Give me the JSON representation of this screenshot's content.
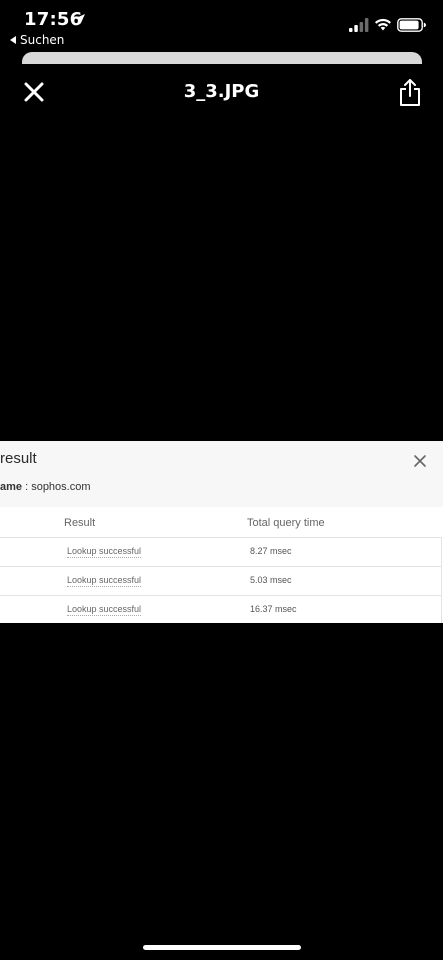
{
  "status_bar": {
    "time": "17:56",
    "back_label": "Suchen",
    "icons": [
      "location-arrow-icon",
      "cellular-signal-icon",
      "wifi-icon",
      "battery-icon"
    ]
  },
  "nav": {
    "title": "3_3.JPG",
    "close_icon": "close-icon",
    "share_icon": "share-icon"
  },
  "image": {
    "dialog_title": "result",
    "name_label": "ame",
    "name_value": " : sophos.com",
    "columns": [
      "Result",
      "Total query time"
    ],
    "rows": [
      {
        "result": "Lookup successful",
        "time": "8.27 msec"
      },
      {
        "result": "Lookup successful",
        "time": "5.03 msec"
      },
      {
        "result": "Lookup successful",
        "time": "16.37 msec"
      }
    ]
  },
  "colors": {
    "background": "#000000",
    "foreground": "#ffffff",
    "panel": "#f7f7f7"
  }
}
